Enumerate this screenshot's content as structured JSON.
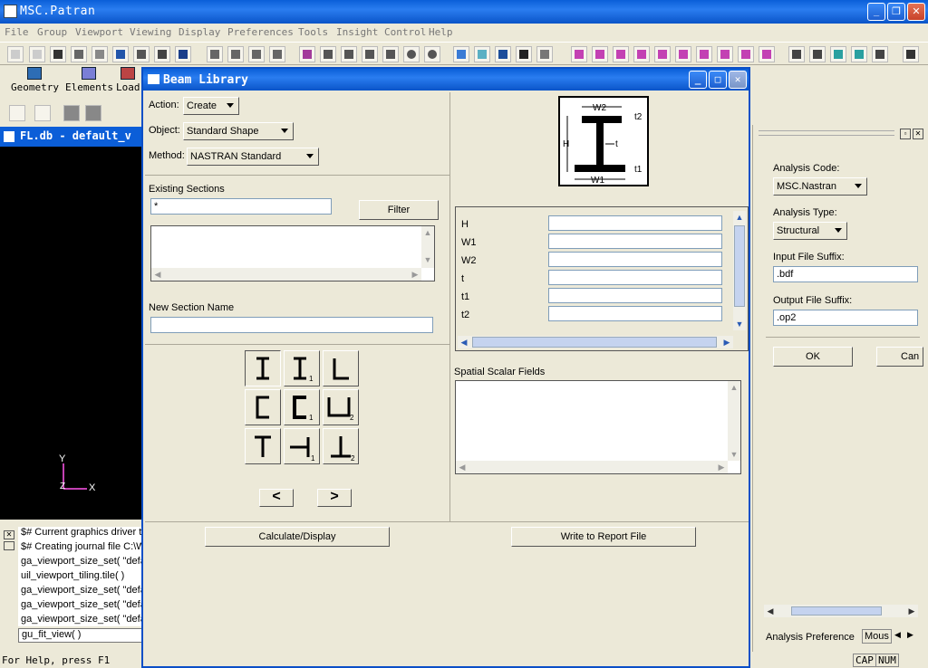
{
  "app": {
    "title": "MSC.Patran"
  },
  "menu": [
    "File",
    "Group",
    "Viewport",
    "Viewing",
    "Display",
    "Preferences",
    "Tools",
    "Insight Control",
    "Help"
  ],
  "appbar": {
    "items": [
      "Geometry",
      "Elements",
      "Load"
    ]
  },
  "viewport": {
    "title": "FL.db - default_v",
    "axis_y": "Y",
    "axis_x": "X",
    "axis_z": "Z"
  },
  "history": {
    "lines": [
      "$# Current graphics driver ty",
      "$# Creating journal file C:\\W",
      "ga_viewport_size_set( \"defa",
      "uil_viewport_tiling.tile( )",
      "ga_viewport_size_set( \"defa",
      "ga_viewport_size_set( \"defa",
      "ga_viewport_size_set( \"defa"
    ],
    "command": "gu_fit_view( )"
  },
  "status": {
    "help": "For Help, press F1",
    "cap": "CAP",
    "num": "NUM"
  },
  "dialog": {
    "title": "Beam Library",
    "action_label": "Action:",
    "action_value": "Create",
    "object_label": "Object:",
    "object_value": "Standard Shape",
    "method_label": "Method:",
    "method_value": "NASTRAN Standard",
    "existing_label": "Existing Sections",
    "existing_filter_value": "*",
    "filter_button": "Filter",
    "new_section_label": "New Section Name",
    "prev_button": "<",
    "next_button": ">",
    "calc_button": "Calculate/Display",
    "report_button": "Write to Report File",
    "spatial_label": "Spatial Scalar Fields",
    "dims": [
      {
        "name": "H",
        "value": ""
      },
      {
        "name": "W1",
        "value": ""
      },
      {
        "name": "W2",
        "value": ""
      },
      {
        "name": "t",
        "value": ""
      },
      {
        "name": "t1",
        "value": ""
      },
      {
        "name": "t2",
        "value": ""
      }
    ],
    "diagram": {
      "w2": "W2",
      "w1": "W1",
      "h": "H",
      "t": "t",
      "t1": "t1",
      "t2": "t2"
    },
    "shapes": [
      "I",
      "I1",
      "L",
      "C",
      "C1",
      "U2",
      "T",
      "T1",
      "T2"
    ],
    "shape_subs": [
      "",
      "1",
      "",
      "",
      "1",
      "2",
      "",
      "1",
      "2"
    ]
  },
  "analysis": {
    "code_label": "Analysis Code:",
    "code_value": "MSC.Nastran",
    "type_label": "Analysis Type:",
    "type_value": "Structural",
    "input_suffix_label": "Input File Suffix:",
    "input_suffix_value": ".bdf",
    "output_suffix_label": "Output File Suffix:",
    "output_suffix_value": ".op2",
    "ok_button": "OK",
    "cancel_button": "Can",
    "tab_label": "Analysis Preference",
    "tab2_label": "Mous"
  }
}
